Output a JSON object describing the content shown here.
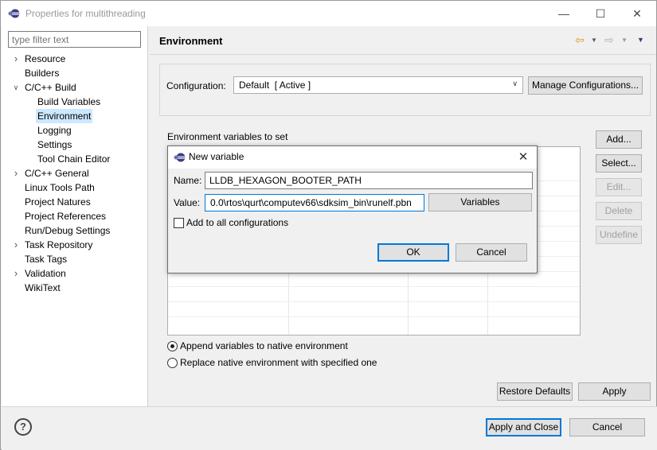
{
  "window": {
    "title": "Properties for multithreading",
    "minimize_icon": "minimize-icon",
    "maximize_icon": "maximize-icon",
    "close_icon": "close-icon"
  },
  "filter": {
    "placeholder": "type filter text"
  },
  "tree": [
    {
      "label": "Resource",
      "expander": "collapsed",
      "level": 0
    },
    {
      "label": "Builders",
      "expander": "none",
      "level": 0
    },
    {
      "label": "C/C++ Build",
      "expander": "expanded",
      "level": 0
    },
    {
      "label": "Build Variables",
      "expander": "none",
      "level": 1
    },
    {
      "label": "Environment",
      "expander": "none",
      "level": 1,
      "selected": true
    },
    {
      "label": "Logging",
      "expander": "none",
      "level": 1
    },
    {
      "label": "Settings",
      "expander": "none",
      "level": 1
    },
    {
      "label": "Tool Chain Editor",
      "expander": "none",
      "level": 1
    },
    {
      "label": "C/C++ General",
      "expander": "collapsed",
      "level": 0
    },
    {
      "label": "Linux Tools Path",
      "expander": "none",
      "level": 0
    },
    {
      "label": "Project Natures",
      "expander": "none",
      "level": 0
    },
    {
      "label": "Project References",
      "expander": "none",
      "level": 0
    },
    {
      "label": "Run/Debug Settings",
      "expander": "none",
      "level": 0
    },
    {
      "label": "Task Repository",
      "expander": "collapsed",
      "level": 0
    },
    {
      "label": "Task Tags",
      "expander": "none",
      "level": 0
    },
    {
      "label": "Validation",
      "expander": "collapsed",
      "level": 0
    },
    {
      "label": "WikiText",
      "expander": "none",
      "level": 0
    }
  ],
  "page": {
    "title": "Environment",
    "configuration_label": "Configuration:",
    "configuration_value": "Default  [ Active ]",
    "manage_configurations": "Manage Configurations...",
    "env_vars_label": "Environment variables to set",
    "buttons": {
      "add": "Add...",
      "select": "Select...",
      "edit": "Edit...",
      "delete": "Delete",
      "undefine": "Undefine"
    },
    "append_option": "Append variables to native environment",
    "replace_option": "Replace native environment with specified one",
    "selected_option": "append",
    "restore_defaults": "Restore Defaults",
    "apply": "Apply"
  },
  "footer": {
    "help": "?",
    "apply_and_close": "Apply and Close",
    "cancel": "Cancel"
  },
  "dialog": {
    "title": "New variable",
    "name_label": "Name:",
    "name_value": "LLDB_HEXAGON_BOOTER_PATH",
    "value_label": "Value:",
    "value_value": "0.0\\rtos\\qurt\\computev66\\sdksim_bin\\runelf.pbn",
    "variables_button": "Variables",
    "add_to_all_label": "Add to all configurations",
    "add_to_all_checked": false,
    "ok": "OK",
    "cancel": "Cancel"
  }
}
